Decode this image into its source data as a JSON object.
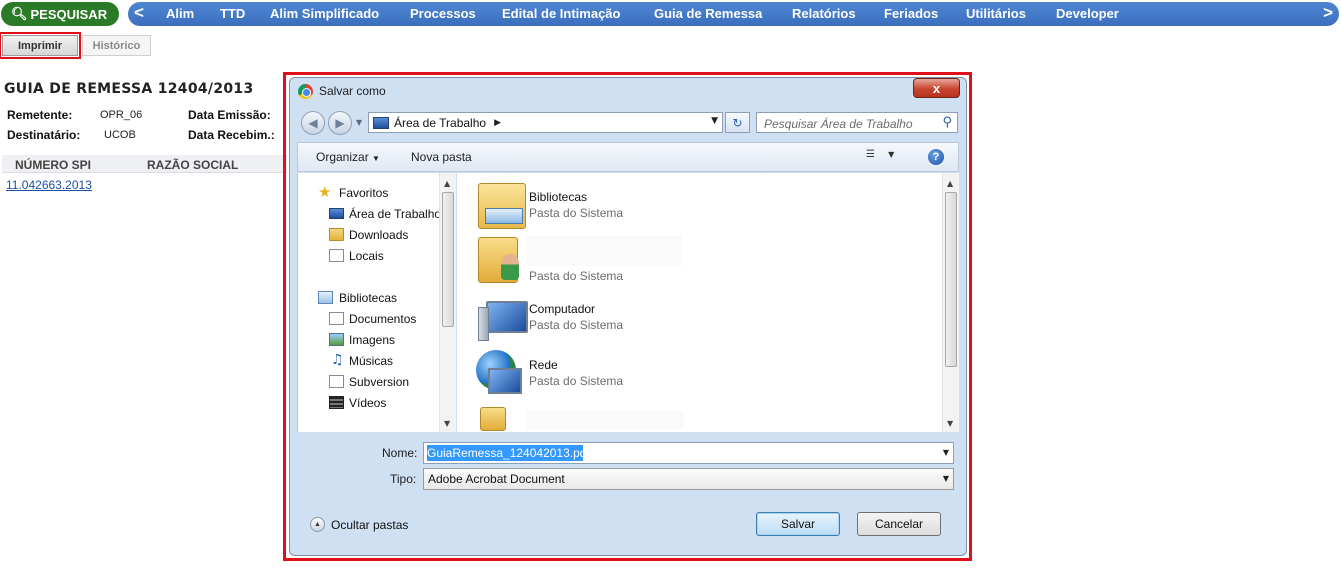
{
  "app": {
    "search_label": "PESQUISAR",
    "nav_left_arrow": "<",
    "nav_right_arrow": ">",
    "nav_items": [
      "Alim",
      "TTD",
      "Alim Simplificado",
      "Processos",
      "Edital de Intimação",
      "Guia de Remessa",
      "Relatórios",
      "Feriados",
      "Utilitários",
      "Developer"
    ],
    "tabs": [
      "Imprimir",
      "Histórico"
    ]
  },
  "document": {
    "title": "GUIA DE REMESSA 12404/2013",
    "remetente_label": "Remetente:",
    "remetente_value": "OPR_06",
    "destinatario_label": "Destinatário:",
    "destinatario_value": "UCOB",
    "data_emissao_label": "Data Emissão:",
    "data_recebim_label": "Data Recebim.:",
    "columns": [
      "NÚMERO SPI",
      "RAZÃO SOCIAL"
    ],
    "rows": [
      {
        "spi": "11.042663.2013"
      }
    ]
  },
  "dialog": {
    "title": "Salvar como",
    "close_glyph": "x",
    "address_path": "Área de Trabalho",
    "search_placeholder": "Pesquisar Área de Trabalho",
    "toolbar": {
      "organize": "Organizar",
      "new_folder": "Nova pasta",
      "help": "?"
    },
    "nav_tree": {
      "favorites_header": "Favoritos",
      "favorites": [
        "Área de Trabalho",
        "Downloads",
        "Locais"
      ],
      "libraries_header": "Bibliotecas",
      "libraries": [
        "Documentos",
        "Imagens",
        "Músicas",
        "Subversion",
        "Vídeos"
      ]
    },
    "items": [
      {
        "name": "Bibliotecas",
        "type": "Pasta do Sistema",
        "icon": "libraries-folder-icon"
      },
      {
        "name": "",
        "type": "Pasta do Sistema",
        "icon": "user-folder-icon"
      },
      {
        "name": "Computador",
        "type": "Pasta do Sistema",
        "icon": "computer-icon"
      },
      {
        "name": "Rede",
        "type": "Pasta do Sistema",
        "icon": "network-icon"
      },
      {
        "name": "",
        "type": "",
        "icon": "folder-icon"
      }
    ],
    "name_label": "Nome:",
    "name_value": "GuiaRemessa_124042013.pdf",
    "type_label": "Tipo:",
    "type_value": "Adobe Acrobat Document",
    "hide_folders": "Ocultar pastas",
    "save": "Salvar",
    "cancel": "Cancelar"
  }
}
